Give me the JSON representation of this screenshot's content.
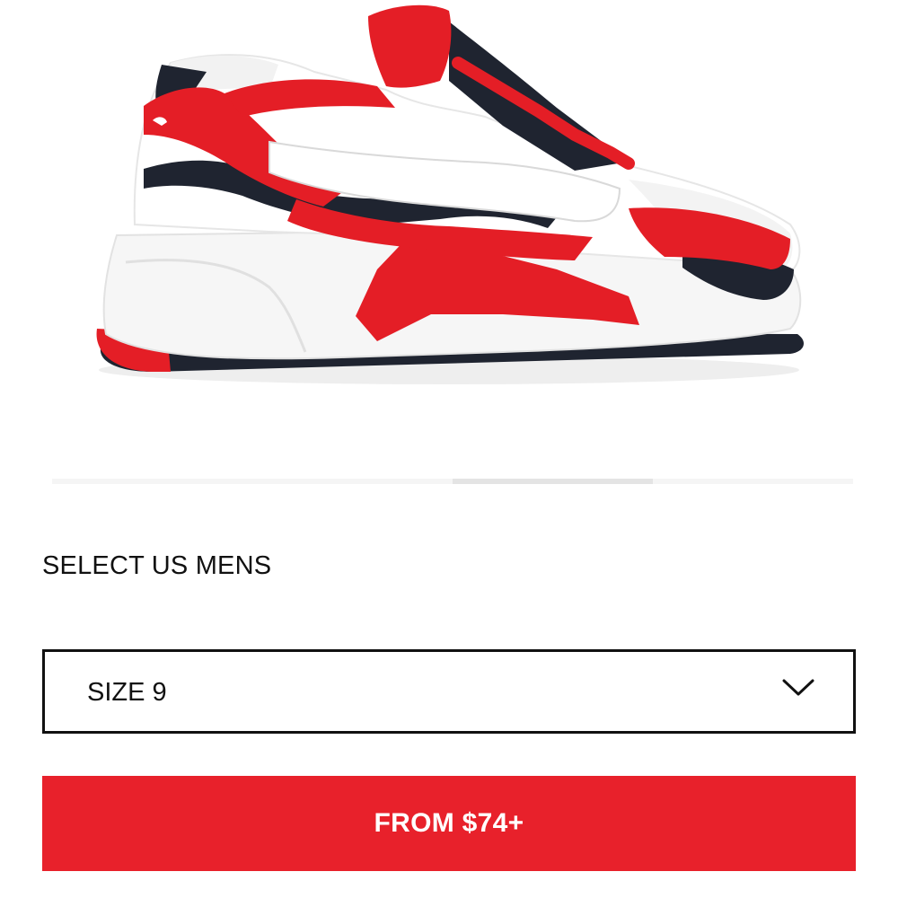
{
  "product": {
    "image_icon": "sneaker-product-image",
    "colors": {
      "red": "#e41e26",
      "white": "#ffffff",
      "navy": "#1f2430",
      "mesh": "#f2f2f2",
      "midsole": "#f6f6f6"
    }
  },
  "carousel": {
    "slide_count": 4,
    "active_index": 2
  },
  "size_section": {
    "heading": "SELECT US MENS",
    "selected_value": "SIZE 9",
    "dropdown_icon": "chevron-down-icon"
  },
  "cta": {
    "label": "FROM $74+",
    "color": "#e8212b"
  }
}
